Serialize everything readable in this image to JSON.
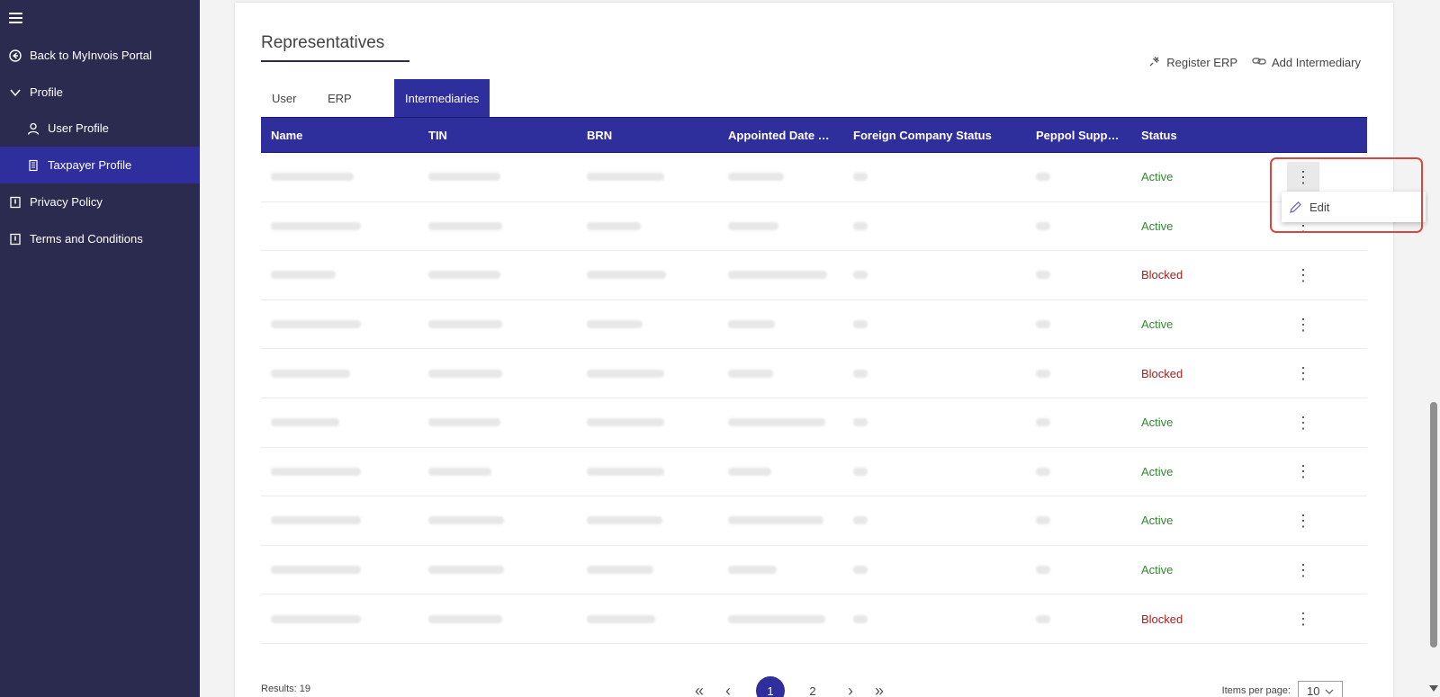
{
  "sidebar": {
    "items": [
      {
        "label": "Back to MyInvois Portal",
        "icon": "back-circle-icon"
      },
      {
        "label": "Profile",
        "icon": "chevron-down-icon"
      },
      {
        "label": "User Profile",
        "icon": "person-icon"
      },
      {
        "label": "Taxpayer Profile",
        "icon": "building-icon"
      },
      {
        "label": "Privacy Policy",
        "icon": "book-icon"
      },
      {
        "label": "Terms and Conditions",
        "icon": "book-icon"
      }
    ]
  },
  "section": {
    "title": "Representatives"
  },
  "actions": {
    "register_erp": "Register ERP",
    "add_intermediary": "Add Intermediary"
  },
  "tabs": [
    {
      "label": "User"
    },
    {
      "label": "ERP"
    },
    {
      "label": "Intermediaries"
    }
  ],
  "table": {
    "headers": [
      "Name",
      "TIN",
      "BRN",
      "Appointed Date Fr...",
      "Foreign Company Status",
      "Peppol Suppor...",
      "Status"
    ],
    "rows": [
      {
        "status": "Active"
      },
      {
        "status": "Active"
      },
      {
        "status": "Blocked"
      },
      {
        "status": "Active"
      },
      {
        "status": "Blocked"
      },
      {
        "status": "Active"
      },
      {
        "status": "Active"
      },
      {
        "status": "Active"
      },
      {
        "status": "Active"
      },
      {
        "status": "Blocked"
      }
    ]
  },
  "menu": {
    "edit": "Edit"
  },
  "footer": {
    "results": "Results: 19",
    "current_page": "1",
    "next_page": "2",
    "items_per_page_label": "Items per page:",
    "items_per_page_value": "10"
  },
  "colors": {
    "sidebar": "#2b2b4f",
    "accent": "#2e2e9c",
    "active": "#2f8a2f",
    "blocked": "#a32121",
    "highlight": "#d9463e"
  }
}
